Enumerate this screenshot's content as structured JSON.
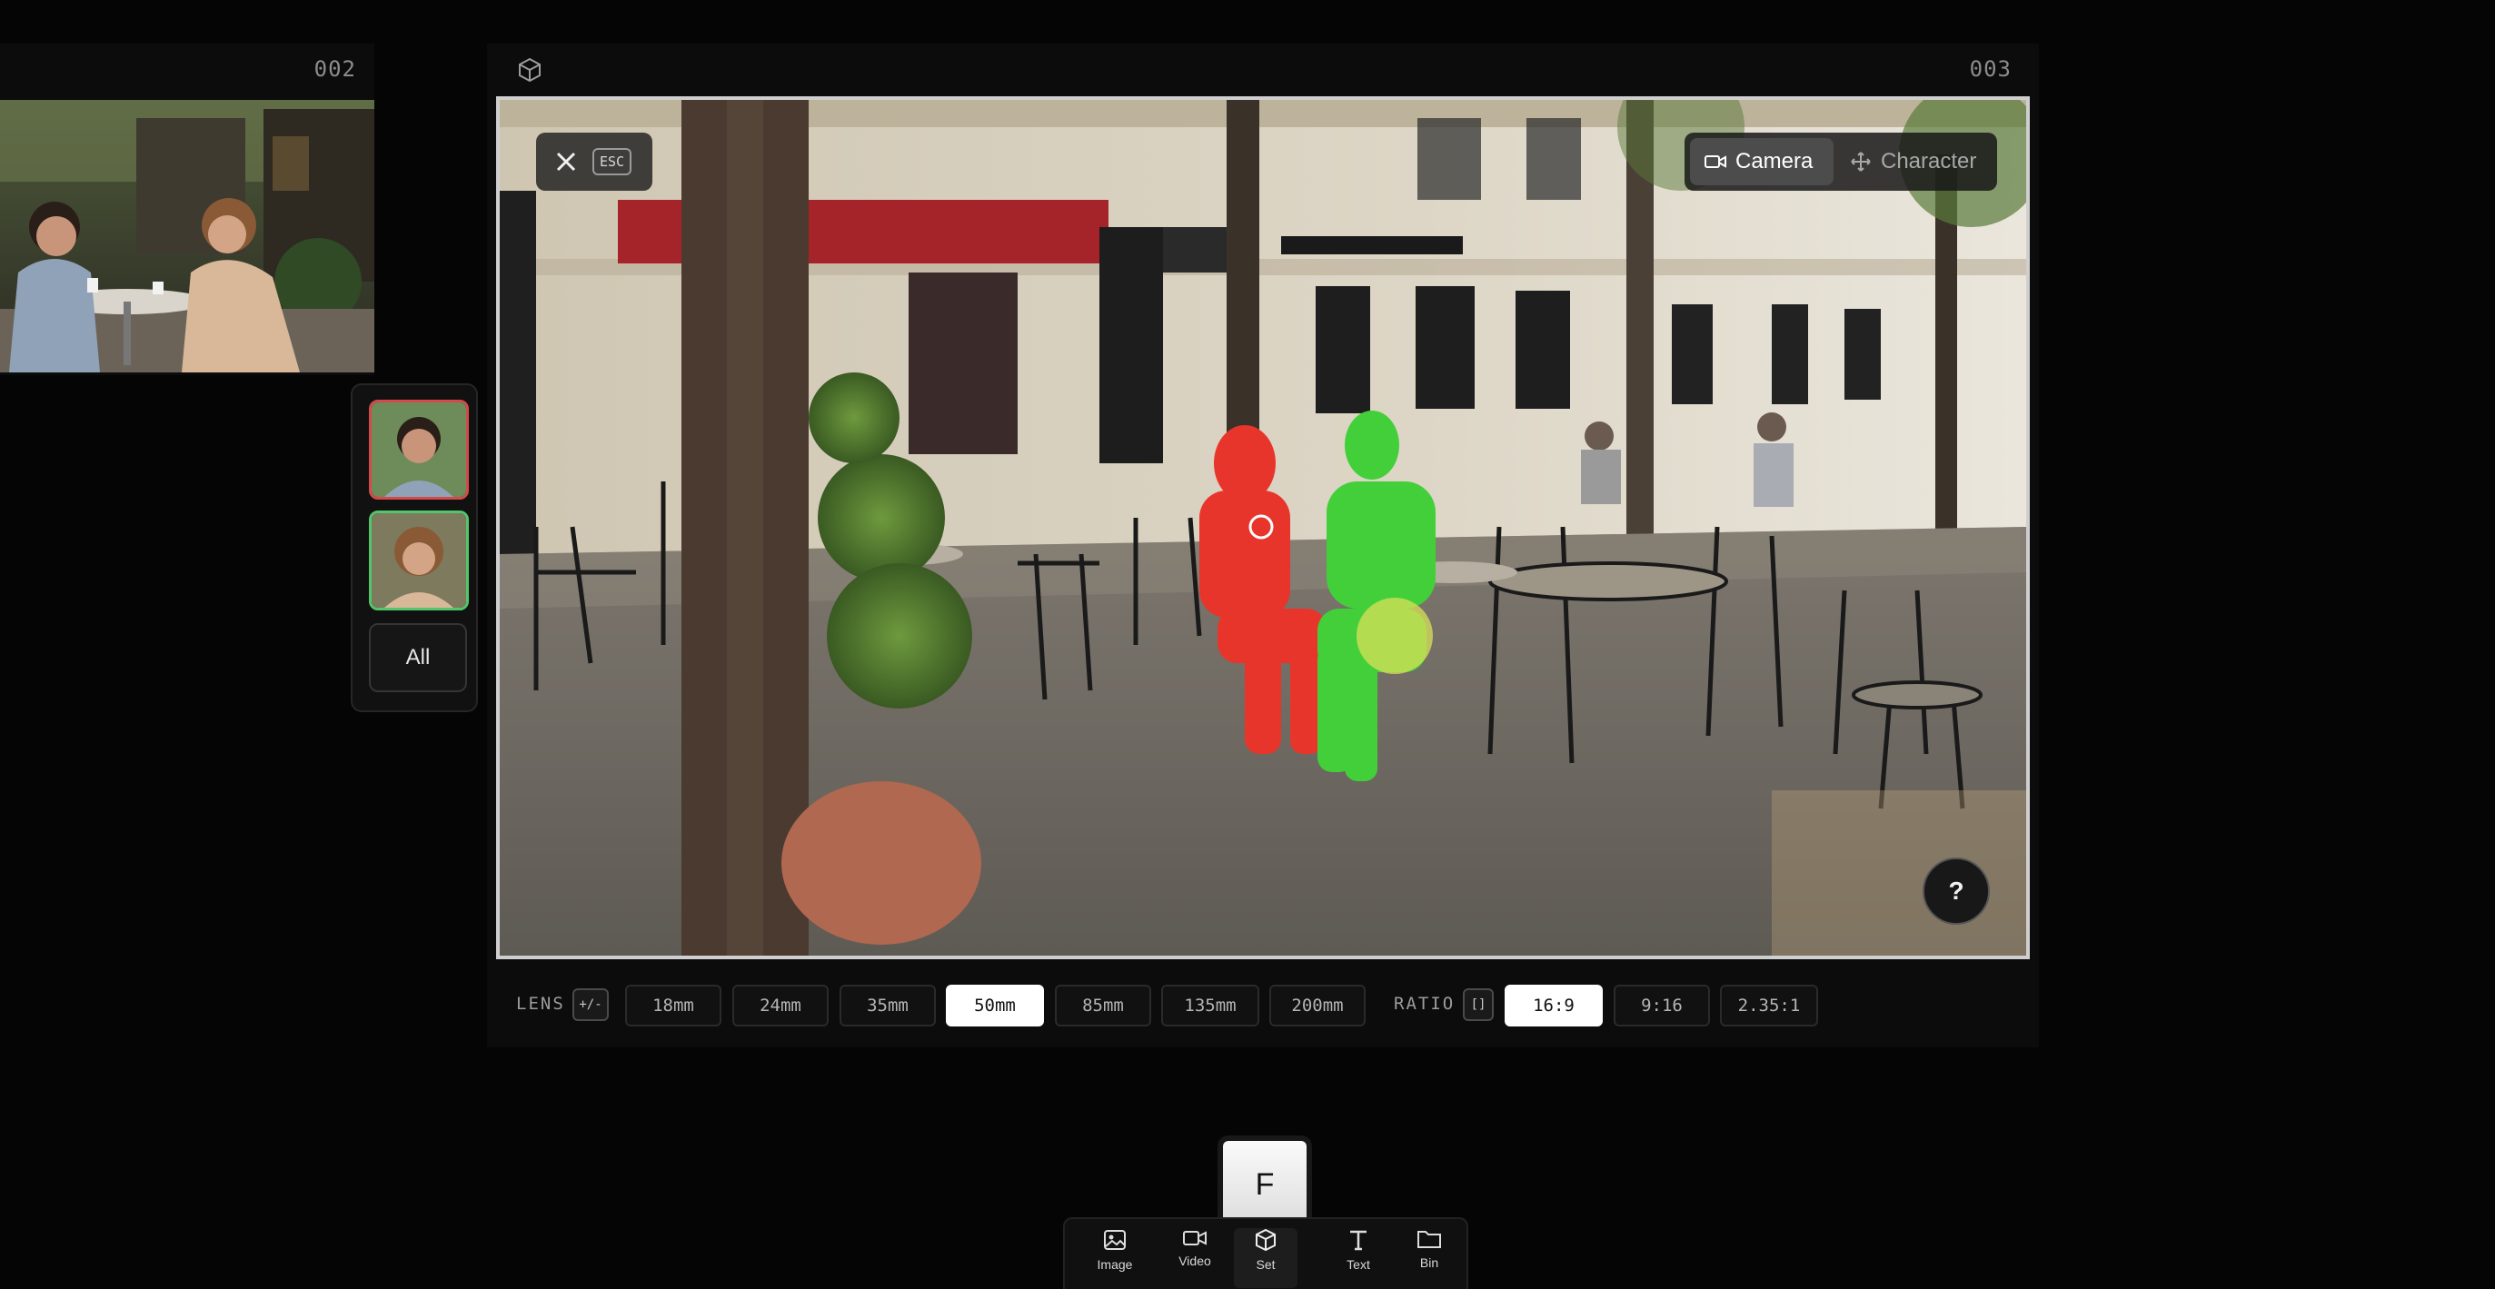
{
  "panels": {
    "left": {
      "id": "002"
    },
    "main": {
      "id": "003"
    }
  },
  "characters": {
    "all_label": "All",
    "colors": [
      "#d44a4a",
      "#52c66a"
    ]
  },
  "viewport": {
    "esc_key": "ESC",
    "modes": {
      "camera": "Camera",
      "character": "Character",
      "active": "Camera"
    },
    "help": "?"
  },
  "controls": {
    "lens_label": "LENS",
    "lens_toggle": "+/-",
    "lenses": [
      "18mm",
      "24mm",
      "35mm",
      "50mm",
      "85mm",
      "135mm",
      "200mm"
    ],
    "lens_selected": "50mm",
    "ratio_label": "RATIO",
    "ratio_toggle": "[]",
    "ratios": [
      "16:9",
      "9:16",
      "2.35:1"
    ],
    "ratio_selected": "16:9"
  },
  "dock": {
    "key_hint": "F",
    "items": [
      {
        "label": "Image",
        "icon": "image-icon"
      },
      {
        "label": "Video",
        "icon": "video-icon"
      },
      {
        "label": "Set",
        "icon": "cube-icon"
      },
      {
        "label": "Text",
        "icon": "text-icon"
      },
      {
        "label": "Bin",
        "icon": "folder-icon"
      }
    ],
    "active": "Set"
  }
}
